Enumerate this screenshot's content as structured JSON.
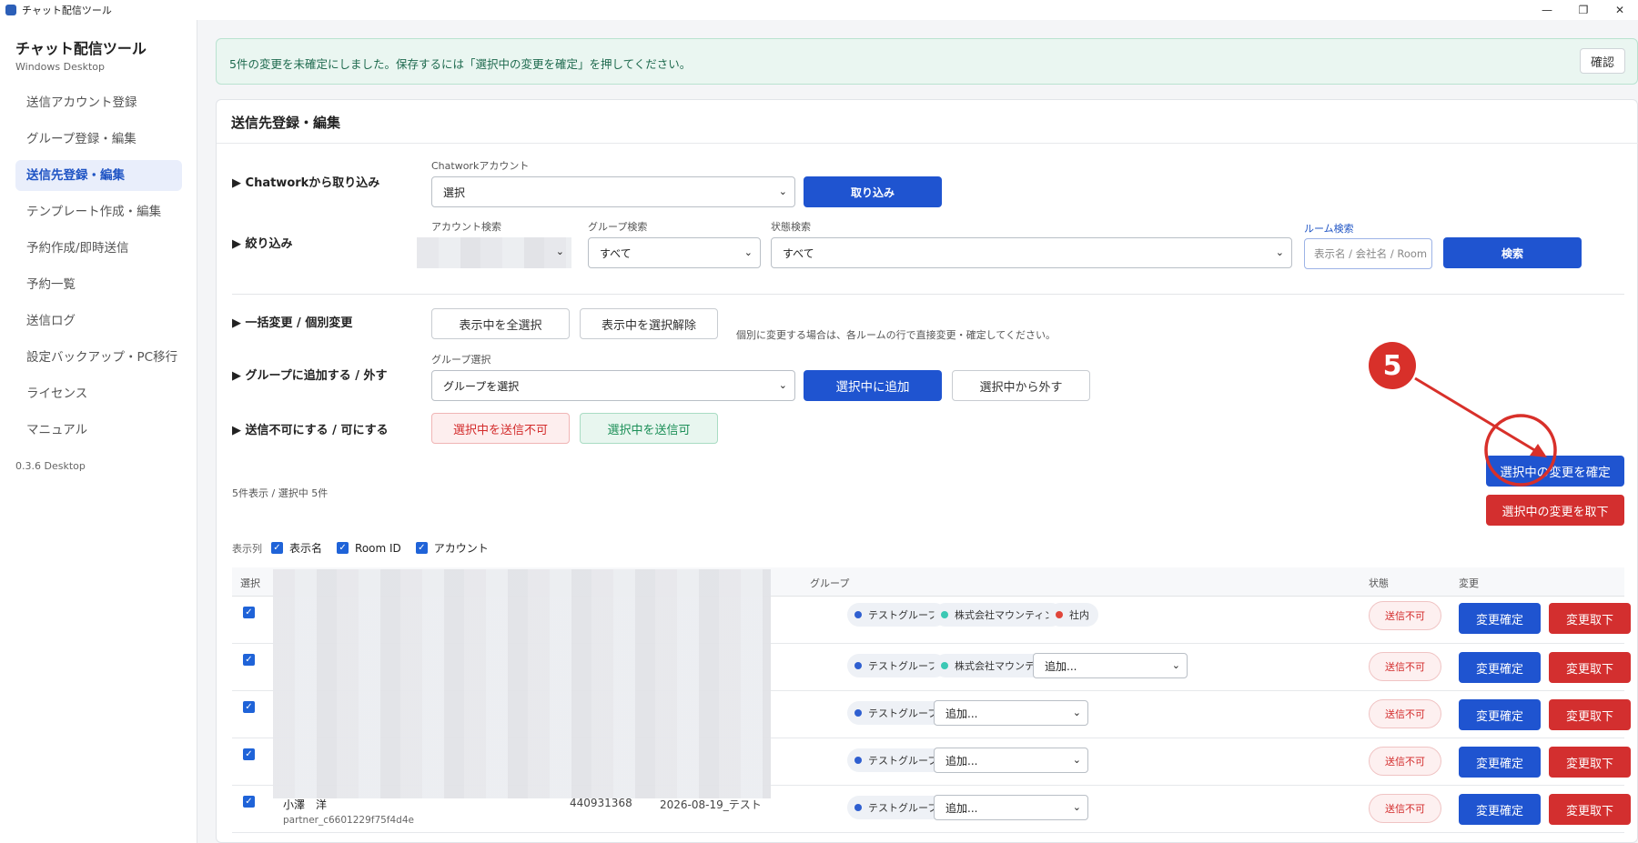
{
  "window": {
    "title": "チャット配信ツール",
    "controls": [
      "—",
      "❐",
      "✕"
    ]
  },
  "sidebar": {
    "app_name": "チャット配信ツール",
    "platform": "Windows Desktop",
    "items": [
      {
        "label": "送信アカウント登録",
        "active": false
      },
      {
        "label": "グループ登録・編集",
        "active": false
      },
      {
        "label": "送信先登録・編集",
        "active": true
      },
      {
        "label": "テンプレート作成・編集",
        "active": false
      },
      {
        "label": "予約作成/即時送信",
        "active": false
      },
      {
        "label": "予約一覧",
        "active": false
      },
      {
        "label": "送信ログ",
        "active": false
      },
      {
        "label": "設定バックアップ・PC移行",
        "active": false
      },
      {
        "label": "ライセンス",
        "active": false
      },
      {
        "label": "マニュアル",
        "active": false
      }
    ],
    "version": "0.3.6 Desktop"
  },
  "notice": {
    "message": "5件の変更を未確定にしました。保存するには「選択中の変更を確定」を押してください。",
    "ok_label": "確認"
  },
  "panel": {
    "title": "送信先登録・編集",
    "import": {
      "section": "▶ Chatworkから取り込み",
      "account_label": "Chatworkアカウント",
      "account_value": "選択",
      "import_button": "取り込み"
    },
    "filter": {
      "section": "▶ 絞り込み",
      "account_label": "アカウント検索",
      "group_label": "グループ検索",
      "group_value": "すべて",
      "status_label": "状態検索",
      "status_value": "すべて",
      "room_label": "ルーム検索",
      "room_placeholder": "表示名 / 会社名 / Room",
      "search_button": "検索"
    },
    "bulk": {
      "section": "▶ 一括変更 / 個別変更",
      "select_all": "表示中を全選択",
      "deselect_all": "表示中を選択解除",
      "hint": "個別に変更する場合は、各ルームの行で直接変更・確定してください。"
    },
    "group_edit": {
      "section": "▶ グループに追加する / 外す",
      "label": "グループ選択",
      "value": "グループを選択",
      "add_button": "選択中に追加",
      "remove_button": "選択中から外す"
    },
    "send_toggle": {
      "section": "▶ 送信不可にする / 可にする",
      "disable_button": "選択中を送信不可",
      "enable_button": "選択中を送信可"
    },
    "commit": {
      "confirm_button": "選択中の変更を確定",
      "cancel_button": "選択中の変更を取下"
    },
    "count_text": "5件表示 / 選択中 5件",
    "columns": {
      "label": "表示列",
      "items": [
        "表示名",
        "Room ID",
        "アカウント"
      ]
    },
    "table": {
      "headers": {
        "select": "選択",
        "group": "グループ",
        "status": "状態",
        "change": "変更"
      },
      "rows": [
        {
          "groups": [
            "テストグループ",
            "株式会社マウンティン",
            "社内"
          ],
          "add": "",
          "status": "送信不可",
          "confirm": "変更確定",
          "cancel": "変更取下"
        },
        {
          "groups": [
            "テストグループ",
            "株式会社マウンティン"
          ],
          "add": "追加...",
          "status": "送信不可",
          "confirm": "変更確定",
          "cancel": "変更取下"
        },
        {
          "groups": [
            "テストグループ"
          ],
          "add": "追加...",
          "status": "送信不可",
          "confirm": "変更確定",
          "cancel": "変更取下"
        },
        {
          "groups": [
            "テストグループ"
          ],
          "add": "追加...",
          "status": "送信不可",
          "confirm": "変更確定",
          "cancel": "変更取下"
        },
        {
          "name": "小澤　洋",
          "sub": "partner_c6601229f75f4d4e",
          "room_id": "440931368",
          "account": "2026-08-19_テスト",
          "groups": [
            "テストグループ"
          ],
          "add": "追加...",
          "status": "送信不可",
          "confirm": "変更確定",
          "cancel": "変更取下"
        }
      ]
    },
    "group_colors": {
      "テストグループ": "#2f5fd0",
      "株式会社マウンティン": "#3bc8b4",
      "社内": "#e0453a"
    }
  },
  "annotation": {
    "number": "5",
    "color": "#d8302a"
  }
}
